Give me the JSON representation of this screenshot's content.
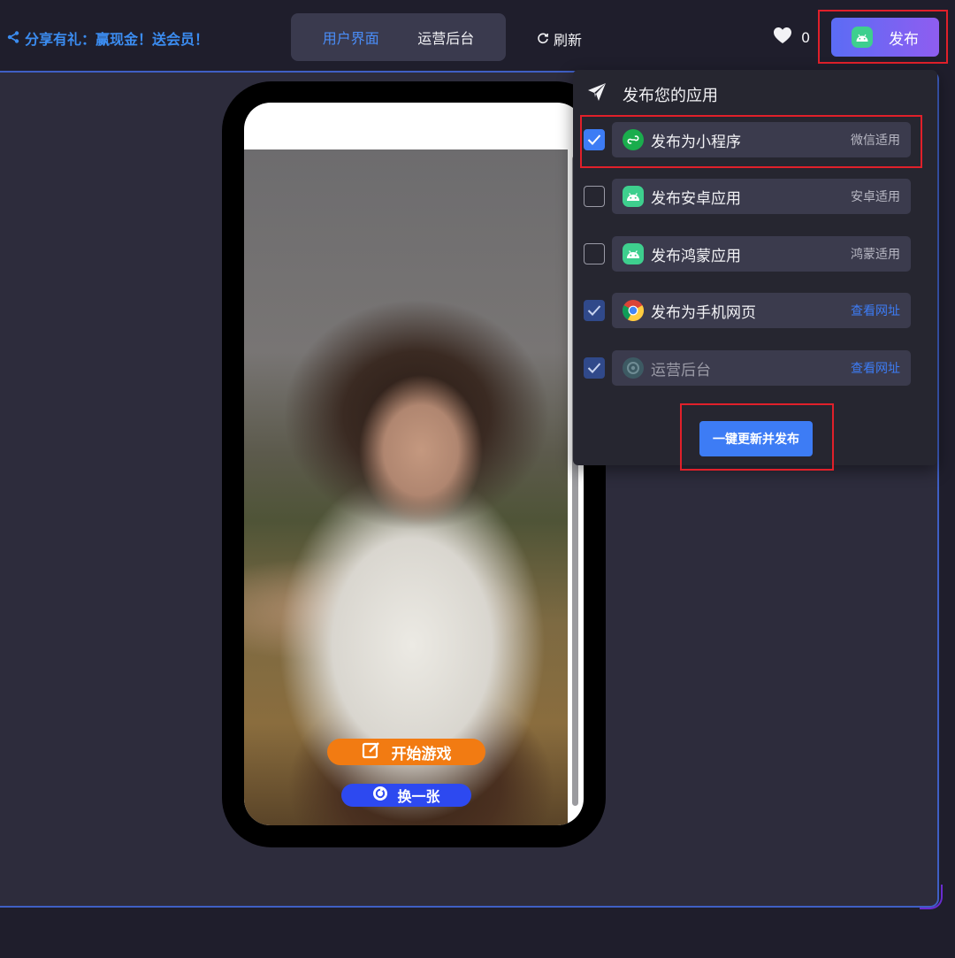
{
  "topbar": {
    "share_text": "分享有礼：赢现金！送会员！",
    "tabs": [
      {
        "label": "用户界面",
        "active": true
      },
      {
        "label": "运营后台",
        "active": false
      }
    ],
    "refresh_label": "刷新",
    "like_count": "0",
    "publish_label": "发布"
  },
  "phone": {
    "start_button_label": "开始游戏",
    "swap_button_label": "换一张"
  },
  "publish_panel": {
    "title": "发布您的应用",
    "options": [
      {
        "label": "发布为小程序",
        "tag": "微信适用",
        "checked": true,
        "icon": "wechat-miniprogram-icon"
      },
      {
        "label": "发布安卓应用",
        "tag": "安卓适用",
        "checked": false,
        "icon": "android-icon"
      },
      {
        "label": "发布鸿蒙应用",
        "tag": "鸿蒙适用",
        "checked": false,
        "icon": "android-icon"
      },
      {
        "label": "发布为手机网页",
        "tag": "查看网址",
        "checked": true,
        "icon": "chrome-icon"
      },
      {
        "label": "运营后台",
        "tag": "查看网址",
        "checked": true,
        "icon": "gear-icon"
      }
    ],
    "action_label": "一键更新并发布"
  },
  "colors": {
    "accent": "#3d7cf5",
    "highlight": "#e0202a",
    "start_button": "#f27b12",
    "swap_button": "#2d49f0"
  }
}
